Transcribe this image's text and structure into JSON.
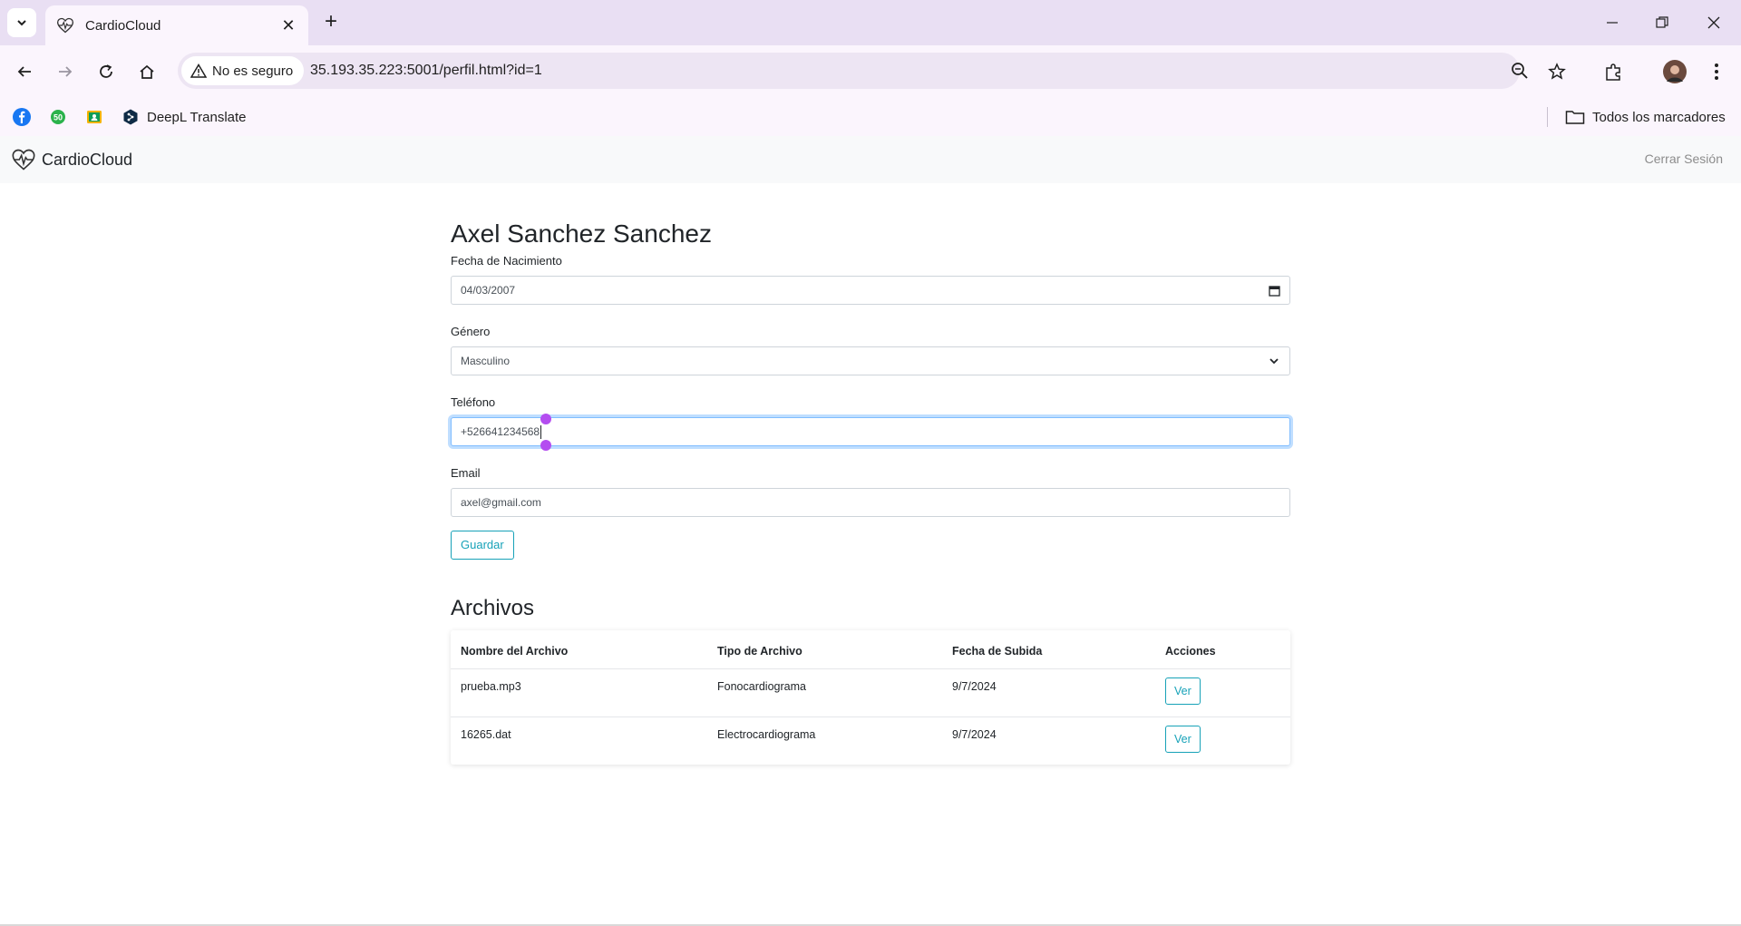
{
  "browser": {
    "tab_title": "CardioCloud",
    "security_label": "No es seguro",
    "url": "35.193.35.223:5001/perfil.html?id=1",
    "bookmarks": {
      "deepl": "DeepL Translate",
      "all_bookmarks": "Todos los marcadores"
    }
  },
  "app": {
    "brand": "CardioCloud",
    "logout": "Cerrar Sesión"
  },
  "profile": {
    "name": "Axel Sanchez Sanchez",
    "birth_label": "Fecha de Nacimiento",
    "birth_value": "04/03/2007",
    "gender_label": "Género",
    "gender_value": "Masculino",
    "phone_label": "Teléfono",
    "phone_value": "+526641234568",
    "email_label": "Email",
    "email_value": "axel@gmail.com",
    "save_label": "Guardar"
  },
  "files": {
    "title": "Archivos",
    "headers": [
      "Nombre del Archivo",
      "Tipo de Archivo",
      "Fecha de Subida",
      "Acciones"
    ],
    "rows": [
      {
        "name": "prueba.mp3",
        "type": "Fonocardiograma",
        "date": "9/7/2024",
        "action": "Ver"
      },
      {
        "name": "16265.dat",
        "type": "Electrocardiograma",
        "date": "9/7/2024",
        "action": "Ver"
      }
    ]
  },
  "colors": {
    "accent": "#17a2b8",
    "tabstrip": "#e9dff3",
    "toolbar": "#fbf5fd"
  }
}
